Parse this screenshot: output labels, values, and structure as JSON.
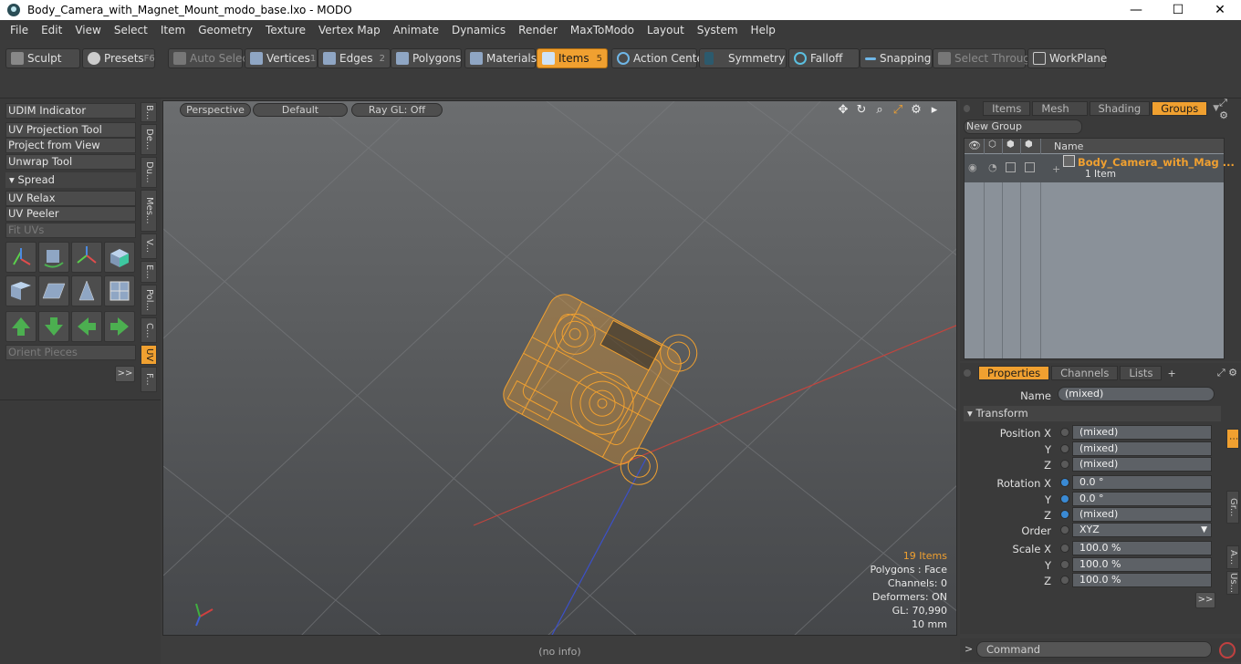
{
  "window": {
    "title": "Body_Camera_with_Magnet_Mount_modo_base.lxo - MODO",
    "minimize": "—",
    "maximize": "☐",
    "close": "✕"
  },
  "menu": [
    "File",
    "Edit",
    "View",
    "Select",
    "Item",
    "Geometry",
    "Texture",
    "Vertex Map",
    "Animate",
    "Dynamics",
    "Render",
    "MaxToModo",
    "Layout",
    "System",
    "Help"
  ],
  "toolbar": {
    "sculpt": "Sculpt",
    "presets": "Presets",
    "presets_key": "F6",
    "auto_select": "Auto Select",
    "vertices": "Vertices",
    "vertices_num": "1",
    "edges": "Edges",
    "edges_num": "2",
    "polygons": "Polygons",
    "materials": "Materials",
    "items": "Items",
    "items_num": "5",
    "action_center": "Action Center",
    "symmetry": "Symmetry",
    "falloff": "Falloff",
    "snapping": "Snapping",
    "select_through": "Select Through",
    "workplane": "WorkPlane"
  },
  "left_panel": {
    "udim": "UDIM Indicator",
    "uv_projection": "UV Projection Tool",
    "project_from_view": "Project from View",
    "unwrap_tool": "Unwrap Tool",
    "spread": "Spread",
    "uv_relax": "UV Relax",
    "uv_peeler": "UV Peeler",
    "fit_uvs": "Fit UVs",
    "orient_pieces": "Orient Pieces",
    "expand": ">>",
    "vtabs": [
      "B...",
      "De...",
      "Du...",
      "Mes...",
      "V...",
      "E...",
      "Pol...",
      "C...",
      "UV",
      "F..."
    ]
  },
  "viewport": {
    "view_mode": "Perspective",
    "shading": "Default",
    "raygl": "Ray GL: Off",
    "items_count": "19 Items",
    "polygons": "Polygons : Face",
    "channels": "Channels: 0",
    "deformers": "Deformers: ON",
    "gl": "GL: 70,990",
    "scale": "10 mm",
    "status": "(no info)",
    "accent": "#f0a030"
  },
  "groups_panel": {
    "tabs": [
      "Items",
      "Mesh ...",
      "Shading",
      "Groups"
    ],
    "new_group": "New Group",
    "col_name": "Name",
    "group_name": "Body_Camera_with_Mag ...",
    "group_sub": "1 Item"
  },
  "properties": {
    "tabs": [
      "Properties",
      "Channels",
      "Lists"
    ],
    "add_tab": "+",
    "name_label": "Name",
    "name_value": "(mixed)",
    "transform": "Transform",
    "position_x_label": "Position X",
    "position_x": "(mixed)",
    "position_y": "(mixed)",
    "position_z": "(mixed)",
    "rotation_x_label": "Rotation X",
    "rotation_x": "0.0 °",
    "rotation_y": "0.0 °",
    "rotation_z": "(mixed)",
    "order_label": "Order",
    "order_value": "XYZ",
    "scale_x_label": "Scale X",
    "scale_x": "100.0 %",
    "scale_y": "100.0 %",
    "scale_z": "100.0 %",
    "y": "Y",
    "z": "Z",
    "expand": ">>",
    "side_tabs": [
      "Gr...",
      "A...",
      "Us..."
    ]
  },
  "command": {
    "prompt": ">",
    "placeholder": "Command"
  }
}
